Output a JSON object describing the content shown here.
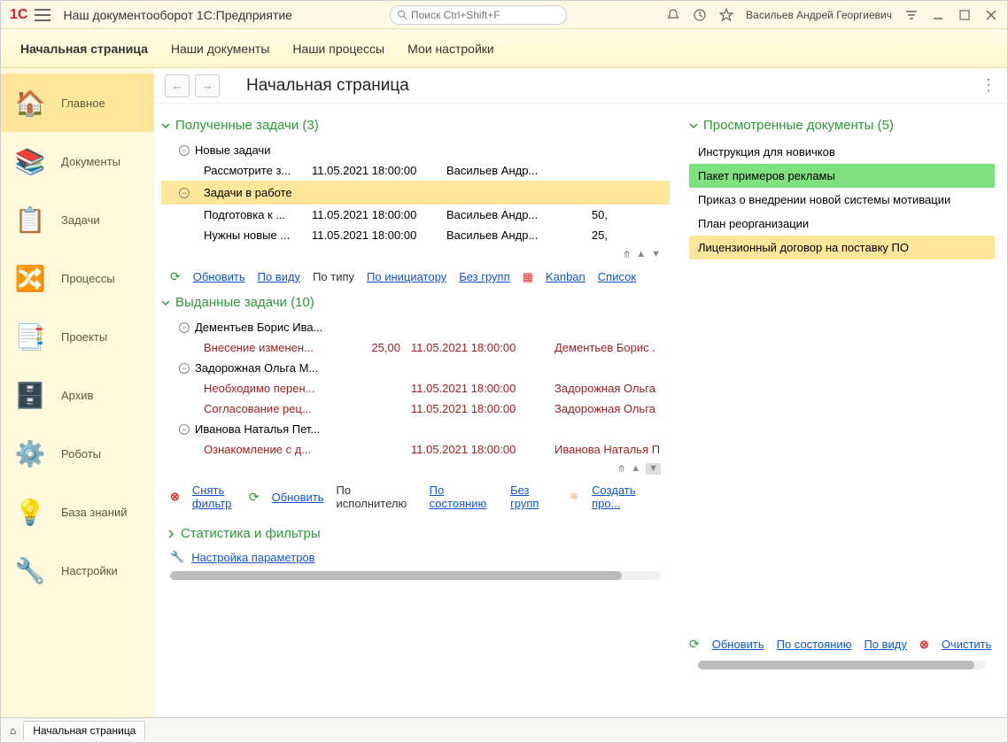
{
  "titlebar": {
    "logo": "1C",
    "title": "Наш документооборот 1С:Предприятие",
    "search_placeholder": "Поиск Ctrl+Shift+F",
    "username": "Васильев Андрей Георгиевич"
  },
  "menubar": [
    "Начальная страница",
    "Наши документы",
    "Наши процессы",
    "Мои настройки"
  ],
  "sidebar": [
    {
      "label": "Главное",
      "icon": "🏠",
      "active": true
    },
    {
      "label": "Документы",
      "icon": "📚"
    },
    {
      "label": "Задачи",
      "icon": "📋"
    },
    {
      "label": "Процессы",
      "icon": "🔀"
    },
    {
      "label": "Проекты",
      "icon": "📑"
    },
    {
      "label": "Архив",
      "icon": "🗄️"
    },
    {
      "label": "Роботы",
      "icon": "⚙️"
    },
    {
      "label": "База знаний",
      "icon": "💡"
    },
    {
      "label": "Настройки",
      "icon": "🔧"
    }
  ],
  "page_title": "Начальная страница",
  "received": {
    "title": "Полученные задачи (3)",
    "groups": [
      {
        "name": "Новые задачи",
        "tasks": [
          {
            "title": "Рассмотрите з...",
            "date": "11.05.2021 18:00:00",
            "user": "Васильев Андр...",
            "val": ""
          }
        ]
      },
      {
        "name": "Задачи в работе",
        "selected": true,
        "tasks": [
          {
            "title": "Подготовка к ...",
            "date": "11.05.2021 18:00:00",
            "user": "Васильев Андр...",
            "val": "50,"
          },
          {
            "title": "Нужны новые ...",
            "date": "11.05.2021 18:00:00",
            "user": "Васильев Андр...",
            "val": "25,"
          }
        ]
      }
    ],
    "toolbar": {
      "refresh": "Обновить",
      "byview": "По виду",
      "bytype": "По типу",
      "byinit": "По инициатору",
      "nogroup": "Без групп",
      "kanban": "Kanban",
      "list": "Список"
    }
  },
  "issued": {
    "title": "Выданные задачи (10)",
    "groups": [
      {
        "name": "Дементьев Борис Ива...",
        "tasks": [
          {
            "title": "Внесение изменен...",
            "val": "25,00",
            "date": "11.05.2021 18:00:00",
            "user": "Дементьев Борис ."
          }
        ]
      },
      {
        "name": "Задорожная Ольга М...",
        "tasks": [
          {
            "title": "Необходимо перен...",
            "val": "",
            "date": "11.05.2021 18:00:00",
            "user": "Задорожная Ольга"
          },
          {
            "title": "Согласование рец...",
            "val": "",
            "date": "11.05.2021 18:00:00",
            "user": "Задорожная Ольга"
          }
        ]
      },
      {
        "name": "Иванова Наталья Пет...",
        "tasks": [
          {
            "title": "Ознакомление с д...",
            "val": "",
            "date": "11.05.2021 18:00:00",
            "user": "Иванова Наталья П"
          }
        ]
      }
    ],
    "toolbar": {
      "clear": "Снять фильтр",
      "refresh": "Обновить",
      "byexec": "По исполнителю",
      "bystate": "По состоянию",
      "nogroup": "Без групп",
      "create": "Создать про..."
    }
  },
  "stats_title": "Статистика и фильтры",
  "params_link": "Настройка параметров",
  "viewed": {
    "title": "Просмотренные документы (5)",
    "items": [
      {
        "label": "Инструкция для новичков",
        "cls": ""
      },
      {
        "label": "Пакет примеров рекламы",
        "cls": "green"
      },
      {
        "label": "Приказ о внедрении новой системы мотивации",
        "cls": ""
      },
      {
        "label": "План реорганизации",
        "cls": ""
      },
      {
        "label": "Лицензионный договор на поставку ПО",
        "cls": "yellow"
      }
    ],
    "toolbar": {
      "refresh": "Обновить",
      "bystate": "По состоянию",
      "byview": "По виду",
      "clear": "Очистить"
    }
  },
  "footer_tab": "Начальная страница"
}
